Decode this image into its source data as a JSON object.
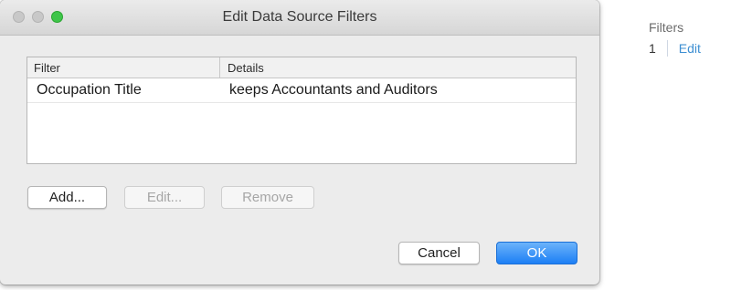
{
  "dialog": {
    "title": "Edit Data Source Filters",
    "table": {
      "headers": [
        "Filter",
        "Details"
      ],
      "rows": [
        {
          "filter": "Occupation Title",
          "details": "keeps Accountants and Auditors"
        }
      ]
    },
    "buttons": {
      "add": "Add...",
      "edit": "Edit...",
      "remove": "Remove",
      "cancel": "Cancel",
      "ok": "OK"
    }
  },
  "side_panel": {
    "title": "Filters",
    "count": "1",
    "edit": "Edit"
  }
}
